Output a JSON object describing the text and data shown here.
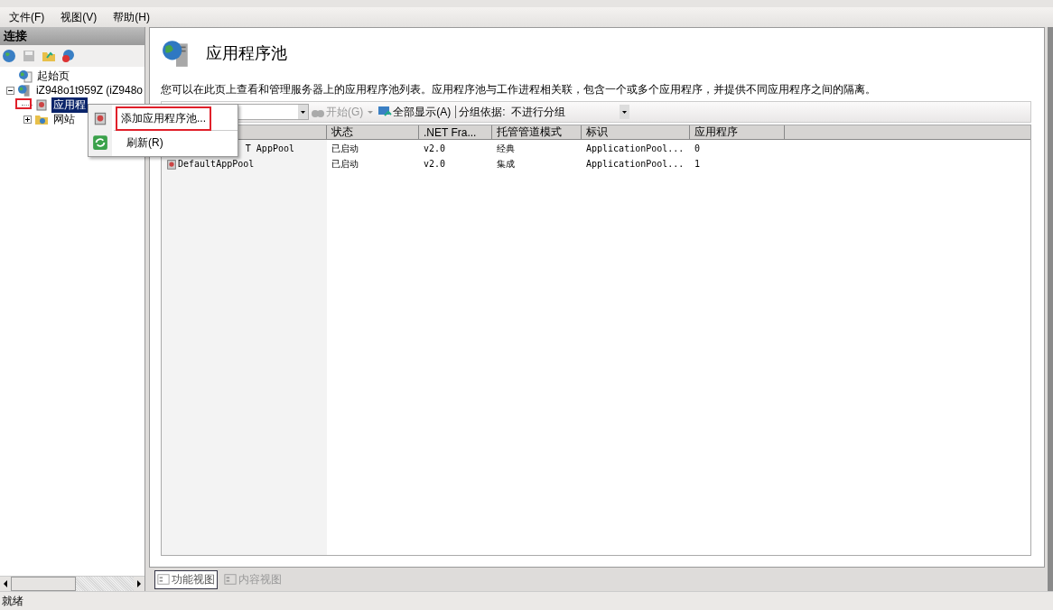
{
  "menu_bar": [
    "文件(F)",
    "视图(V)",
    "帮助(H)"
  ],
  "connections": {
    "title": "连接",
    "tree": [
      {
        "label": "起始页",
        "kind": "start",
        "selected": false
      },
      {
        "label": "iZ948o1t959Z (iZ948o",
        "kind": "server",
        "expanded": true,
        "selected": false,
        "children": [
          {
            "label": "应用程",
            "kind": "pool",
            "selected": true,
            "marked": true
          },
          {
            "label": "网站",
            "kind": "sites",
            "expanded": false,
            "selected": false
          }
        ]
      }
    ]
  },
  "context_menu": [
    {
      "label": "添加应用程序池...",
      "kind": "add",
      "marked": true
    },
    {
      "label": "刷新(R)",
      "kind": "refresh",
      "marked": false
    }
  ],
  "page": {
    "title": "应用程序池",
    "description": "您可以在此页上查看和管理服务器上的应用程序池列表。应用程序池与工作进程相关联，包含一个或多个应用程序，并提供不同应用程序之间的隔离。",
    "toolbar": {
      "start": {
        "label": "开始(G)",
        "disabled": true
      },
      "show_all": "全部显示(A)",
      "group_label": "分组依据:",
      "group_value": "不进行分组"
    },
    "table": {
      "columns": [
        "状态",
        ".NET Fra...",
        "托管管道模式",
        "标识",
        "应用程序"
      ],
      "rows": [
        {
          "name": "T AppPool",
          "cells": [
            "已启动",
            "v2.0",
            "经典",
            "ApplicationPool...",
            "0"
          ]
        },
        {
          "name": "DefaultAppPool",
          "cells": [
            "已启动",
            "v2.0",
            "集成",
            "ApplicationPool...",
            "1"
          ]
        }
      ]
    },
    "view_tabs": [
      {
        "label": "功能视图",
        "selected": true
      },
      {
        "label": "内容视图",
        "selected": false
      }
    ]
  },
  "status_bar": "就绪"
}
